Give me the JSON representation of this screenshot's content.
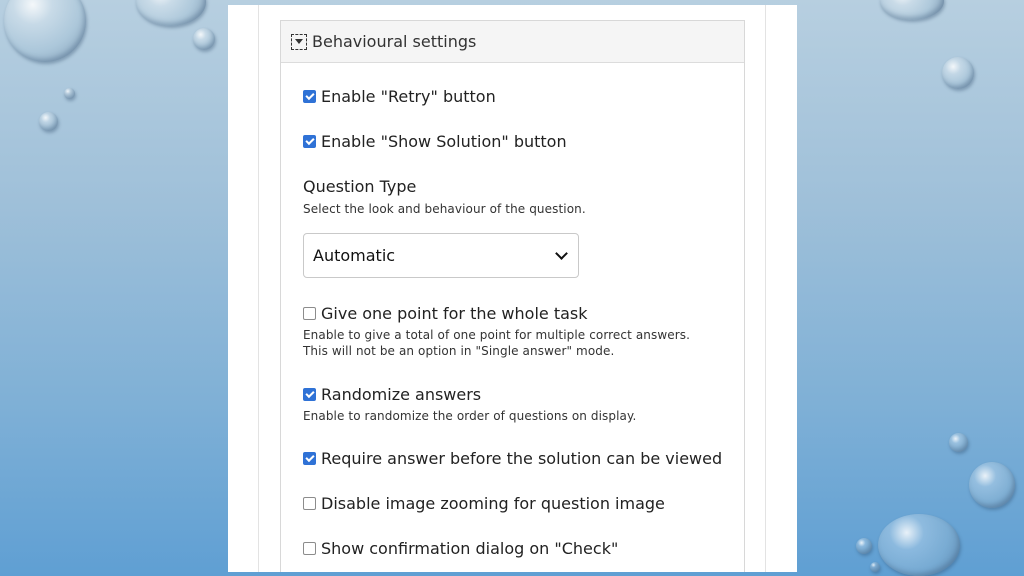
{
  "group": {
    "title": "Behavioural settings"
  },
  "settings": {
    "retry": {
      "label": "Enable \"Retry\" button",
      "checked": true
    },
    "show_solution": {
      "label": "Enable \"Show Solution\" button",
      "checked": true
    },
    "question_type": {
      "title": "Question Type",
      "description": "Select the look and behaviour of the question.",
      "selected": "Automatic"
    },
    "one_point": {
      "label": "Give one point for the whole task",
      "checked": false,
      "description_line1": "Enable to give a total of one point for multiple correct answers.",
      "description_line2": "This will not be an option in \"Single answer\" mode."
    },
    "randomize": {
      "label": "Randomize answers",
      "checked": true,
      "description": "Enable to randomize the order of questions on display."
    },
    "require_answer": {
      "label": "Require answer before the solution can be viewed",
      "checked": true
    },
    "disable_zoom": {
      "label": "Disable image zooming for question image",
      "checked": false
    },
    "confirm_check": {
      "label": "Show confirmation dialog on \"Check\"",
      "checked": false
    }
  },
  "colors": {
    "checkbox_checked": "#2f72d6",
    "background_top": "#b7cfe0",
    "background_bottom": "#5f9fd3"
  }
}
